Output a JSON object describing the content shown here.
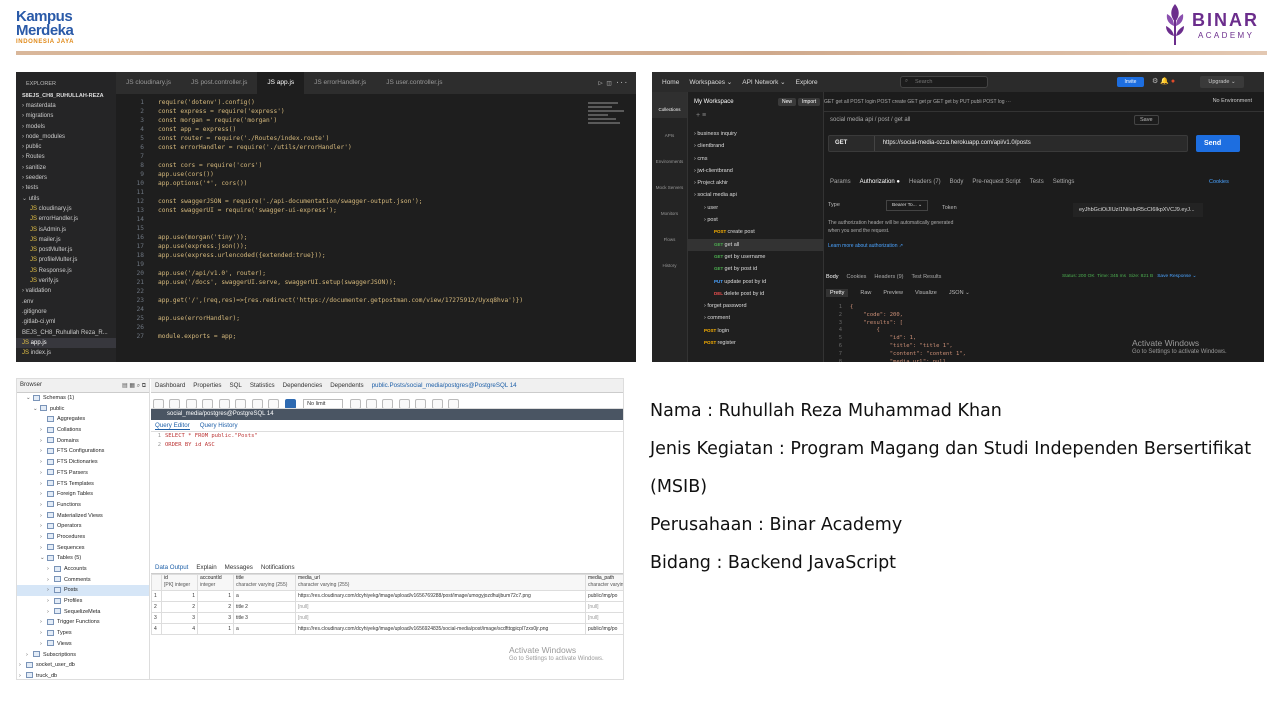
{
  "header": {
    "kampus_line1": "Kampus",
    "kampus_line2": "Merdeka",
    "kampus_sub": "INDONESIA JAYA",
    "binar_name": "BINAR",
    "binar_sub": "ACADEMY",
    "accent_brown": "#cfa98c",
    "binar_purple": "#6b2d8c"
  },
  "vscode": {
    "explorer_title": "EXPLORER",
    "root": "S8EJS_CH8_RUHULLAH-REZA",
    "files": [
      {
        "label": "masterdata",
        "kind": "folder"
      },
      {
        "label": "migrations",
        "kind": "folder"
      },
      {
        "label": "models",
        "kind": "folder"
      },
      {
        "label": "node_modules",
        "kind": "folder"
      },
      {
        "label": "public",
        "kind": "folder"
      },
      {
        "label": "Routes",
        "kind": "folder"
      },
      {
        "label": "sanitize",
        "kind": "folder"
      },
      {
        "label": "seeders",
        "kind": "folder"
      },
      {
        "label": "tests",
        "kind": "folder"
      },
      {
        "label": "utils",
        "kind": "folder-open"
      },
      {
        "label": "cloudinary.js",
        "kind": "js"
      },
      {
        "label": "errorHandler.js",
        "kind": "js"
      },
      {
        "label": "isAdmin.js",
        "kind": "js"
      },
      {
        "label": "mailer.js",
        "kind": "js"
      },
      {
        "label": "postMulter.js",
        "kind": "js"
      },
      {
        "label": "profileMulter.js",
        "kind": "js"
      },
      {
        "label": "Response.js",
        "kind": "js"
      },
      {
        "label": "verify.js",
        "kind": "js"
      },
      {
        "label": "validation",
        "kind": "folder"
      },
      {
        "label": ".env",
        "kind": "file"
      },
      {
        "label": ".gitignore",
        "kind": "file"
      },
      {
        "label": ".gitlab-ci.yml",
        "kind": "file"
      },
      {
        "label": "BEJS_CH8_Ruhullah Reza_R...",
        "kind": "file"
      },
      {
        "label": "app.js",
        "kind": "js"
      },
      {
        "label": "index.js",
        "kind": "js"
      }
    ],
    "tabs": [
      {
        "label": "JS cloudinary.js",
        "active": false
      },
      {
        "label": "JS post.controller.js",
        "active": false
      },
      {
        "label": "JS app.js",
        "active": true
      },
      {
        "label": "JS errorHandler.js",
        "active": false
      },
      {
        "label": "JS user.controller.js",
        "active": false
      }
    ],
    "breadcrumb": "JS app.js > ...",
    "code": [
      {
        "n": "1",
        "t": "require('dotenv').config()"
      },
      {
        "n": "2",
        "t": "const express = require('express')"
      },
      {
        "n": "3",
        "t": "const morgan = require('morgan')"
      },
      {
        "n": "4",
        "t": "const app = express()"
      },
      {
        "n": "5",
        "t": "const router = require('./Routes/index.route')"
      },
      {
        "n": "6",
        "t": "const errorHandler = require('./utils/errorHandler')"
      },
      {
        "n": "7",
        "t": ""
      },
      {
        "n": "8",
        "t": "const cors = require('cors')"
      },
      {
        "n": "9",
        "t": "app.use(cors())"
      },
      {
        "n": "10",
        "t": "app.options('*', cors())"
      },
      {
        "n": "11",
        "t": ""
      },
      {
        "n": "12",
        "t": "const swaggerJSON = require('./api-documentation/swagger-output.json');"
      },
      {
        "n": "13",
        "t": "const swaggerUI = require('swagger-ui-express');"
      },
      {
        "n": "14",
        "t": ""
      },
      {
        "n": "15",
        "t": ""
      },
      {
        "n": "16",
        "t": "app.use(morgan('tiny'));"
      },
      {
        "n": "17",
        "t": "app.use(express.json());"
      },
      {
        "n": "18",
        "t": "app.use(express.urlencoded({extended:true}));"
      },
      {
        "n": "19",
        "t": ""
      },
      {
        "n": "20",
        "t": "app.use('/api/v1.0', router);"
      },
      {
        "n": "21",
        "t": "app.use('/docs', swaggerUI.serve, swaggerUI.setup(swaggerJSON));"
      },
      {
        "n": "22",
        "t": ""
      },
      {
        "n": "23",
        "t": "app.get('/',(req,res)=>{res.redirect('https://documenter.getpostman.com/view/17275912/Uyxq8hva')})"
      },
      {
        "n": "24",
        "t": ""
      },
      {
        "n": "25",
        "t": "app.use(errorHandler);"
      },
      {
        "n": "26",
        "t": ""
      },
      {
        "n": "27",
        "t": "module.exports = app;"
      }
    ]
  },
  "postman": {
    "nav": [
      "Home",
      "Workspaces ⌄",
      "API Network ⌄",
      "Explore"
    ],
    "search": "Search",
    "invite": "Invite",
    "upgrade": "Upgrade ⌄",
    "workspace": "My Workspace",
    "new_btn": "New",
    "import_btn": "Import",
    "rail": [
      "Collections",
      "APIs",
      "Environments",
      "Mock Servers",
      "Monitors",
      "Flows",
      "History"
    ],
    "tree": [
      {
        "label": "business inquiry",
        "method": "",
        "indent": 0
      },
      {
        "label": "clientbrand",
        "method": "",
        "indent": 0
      },
      {
        "label": "cms",
        "method": "",
        "indent": 0
      },
      {
        "label": "jwt-clientbrand",
        "method": "",
        "indent": 0
      },
      {
        "label": "Project akhir",
        "method": "",
        "indent": 0
      },
      {
        "label": "social media api",
        "method": "",
        "indent": 0
      },
      {
        "label": "user",
        "method": "",
        "indent": 1
      },
      {
        "label": "post",
        "method": "",
        "indent": 1
      },
      {
        "label": "create post",
        "method": "POST",
        "indent": 2
      },
      {
        "label": "get all",
        "method": "GET",
        "indent": 2
      },
      {
        "label": "get by username",
        "method": "GET",
        "indent": 2
      },
      {
        "label": "get by post id",
        "method": "GET",
        "indent": 2
      },
      {
        "label": "update post by id",
        "method": "PUT",
        "indent": 2
      },
      {
        "label": "delete post by id",
        "method": "DEL",
        "indent": 2
      },
      {
        "label": "forget password",
        "method": "",
        "indent": 1
      },
      {
        "label": "comment",
        "method": "",
        "indent": 1
      },
      {
        "label": "login",
        "method": "POST",
        "indent": 1
      },
      {
        "label": "register",
        "method": "POST",
        "indent": 1
      }
    ],
    "open_tabs": "GET get all   POST login   POST create   GET get pr   GET get by   PUT publi   POST log   ···",
    "environment": "No Environment",
    "breadcrumb": "social media api  /  post  /  get all",
    "save": "Save",
    "method": "GET",
    "url": "https://social-media-ozza.herokuapp.com/api/v1.0/posts",
    "send": "Send",
    "req_tabs": [
      "Params",
      "Authorization ●",
      "Headers (7)",
      "Body",
      "Pre-request Script",
      "Tests",
      "Settings"
    ],
    "cookies": "Cookies",
    "auth_type_label": "Type",
    "auth_type_value": "Bearer To... ⌄",
    "auth_desc": "The authorization header will be automatically generated when you send the request.",
    "auth_link": "Learn more about authorization ↗",
    "token_label": "Token",
    "token_value": "eyJhbGciOiJIUzI1NiIsInR5cCI6IkpXVCJ9.eyJ...",
    "resp_tabs": [
      "Body",
      "Cookies",
      "Headers (9)",
      "Test Results"
    ],
    "status_code": "Status: 200 OK",
    "status_time": "Time: 345 ms",
    "status_size": "Size: 821 B",
    "save_response": "Save Response ⌄",
    "view_tabs": [
      "Pretty",
      "Raw",
      "Preview",
      "Visualize",
      "JSON ⌄"
    ],
    "json": [
      {
        "n": "1",
        "t": "{"
      },
      {
        "n": "2",
        "t": "    \"code\": 200,"
      },
      {
        "n": "3",
        "t": "    \"results\": ["
      },
      {
        "n": "4",
        "t": "        {"
      },
      {
        "n": "5",
        "t": "            \"id\": 1,"
      },
      {
        "n": "6",
        "t": "            \"title\": \"title 1\","
      },
      {
        "n": "7",
        "t": "            \"content\": \"content 1\","
      },
      {
        "n": "8",
        "t": "            \"media_url\": null,"
      },
      {
        "n": "9",
        "t": "            \"Comments\": ["
      }
    ],
    "watermark_title": "Activate Windows",
    "watermark_sub": "Go to Settings to activate Windows."
  },
  "pgadmin": {
    "browser_title": "Browser",
    "tree": [
      {
        "label": "Schemas (1)",
        "indent": 4,
        "arrow": "⌄"
      },
      {
        "label": "public",
        "indent": 5,
        "arrow": "⌄"
      },
      {
        "label": "Aggregates",
        "indent": 6,
        "arrow": ""
      },
      {
        "label": "Collations",
        "indent": 6,
        "arrow": "›"
      },
      {
        "label": "Domains",
        "indent": 6,
        "arrow": "›"
      },
      {
        "label": "FTS Configurations",
        "indent": 6,
        "arrow": "›"
      },
      {
        "label": "FTS Dictionaries",
        "indent": 6,
        "arrow": "›"
      },
      {
        "label": "FTS Parsers",
        "indent": 6,
        "arrow": "›"
      },
      {
        "label": "FTS Templates",
        "indent": 6,
        "arrow": "›"
      },
      {
        "label": "Foreign Tables",
        "indent": 6,
        "arrow": "›"
      },
      {
        "label": "Functions",
        "indent": 6,
        "arrow": "›"
      },
      {
        "label": "Materialized Views",
        "indent": 6,
        "arrow": "›"
      },
      {
        "label": "Operators",
        "indent": 6,
        "arrow": "›"
      },
      {
        "label": "Procedures",
        "indent": 6,
        "arrow": "›"
      },
      {
        "label": "Sequences",
        "indent": 6,
        "arrow": "›"
      },
      {
        "label": "Tables (5)",
        "indent": 6,
        "arrow": "⌄"
      },
      {
        "label": "Accounts",
        "indent": 7,
        "arrow": "›"
      },
      {
        "label": "Comments",
        "indent": 7,
        "arrow": "›"
      },
      {
        "label": "Posts",
        "indent": 7,
        "arrow": "›",
        "sel": true
      },
      {
        "label": "Profiles",
        "indent": 7,
        "arrow": "›"
      },
      {
        "label": "SequelizeMeta",
        "indent": 7,
        "arrow": "›"
      },
      {
        "label": "Trigger Functions",
        "indent": 6,
        "arrow": "›"
      },
      {
        "label": "Types",
        "indent": 6,
        "arrow": "›"
      },
      {
        "label": "Views",
        "indent": 6,
        "arrow": "›"
      },
      {
        "label": "Subscriptions",
        "indent": 4,
        "arrow": "›"
      },
      {
        "label": "socket_user_db",
        "indent": 3,
        "arrow": "›"
      },
      {
        "label": "truck_db",
        "indent": 3,
        "arrow": "›"
      }
    ],
    "tabs": [
      "Dashboard",
      "Properties",
      "SQL",
      "Statistics",
      "Dependencies",
      "Dependents",
      "public.Posts/social_media/postgres@PostgreSQL 14"
    ],
    "limit": "No limit",
    "connection": "social_media/postgres@PostgreSQL 14",
    "query_tabs": [
      "Query Editor",
      "Query History"
    ],
    "query": [
      {
        "n": "1",
        "t": "SELECT * FROM public.\"Posts\""
      },
      {
        "n": "2",
        "t": "ORDER BY id ASC"
      }
    ],
    "output_tabs": [
      "Data Output",
      "Explain",
      "Messages",
      "Notifications"
    ],
    "columns": [
      {
        "name": "id",
        "type": "[PK] integer"
      },
      {
        "name": "accountId",
        "type": "integer"
      },
      {
        "name": "title",
        "type": "character varying (255)"
      },
      {
        "name": "media_url",
        "type": "character varying (255)"
      },
      {
        "name": "media_path",
        "type": "character varying"
      }
    ],
    "rows": [
      {
        "n": "1",
        "id": "1",
        "acc": "1",
        "title": "a",
        "url": "https://res.cloudinary.com/dcyhiyekg/image/upload/v1656769288/post/image/umogyjozdhuijbum72c7.png",
        "path": "public/img/po"
      },
      {
        "n": "2",
        "id": "2",
        "acc": "2",
        "title": "title 2",
        "url": "[null]",
        "path": "[null]"
      },
      {
        "n": "3",
        "id": "3",
        "acc": "3",
        "title": "title 3",
        "url": "[null]",
        "path": "[null]"
      },
      {
        "n": "4",
        "id": "4",
        "acc": "1",
        "title": "a",
        "url": "https://res.cloudinary.com/dcyhiyekg/image/upload/v1656924835/social-media/post/image/scdfttqgicpl7zxs0jr.png",
        "path": "public/img/po"
      }
    ],
    "watermark_title": "Activate Windows",
    "watermark_sub": "Go to Settings to activate Windows."
  },
  "info": {
    "nama": "Nama : Ruhullah Reza Muhammad Khan",
    "jenis": "Jenis Kegiatan : Program Magang dan Studi Independen Bersertifikat",
    "jenis_cont": "(MSIB)",
    "perusahaan": "Perusahaan : Binar Academy",
    "bidang": "Bidang : Backend JavaScript"
  }
}
